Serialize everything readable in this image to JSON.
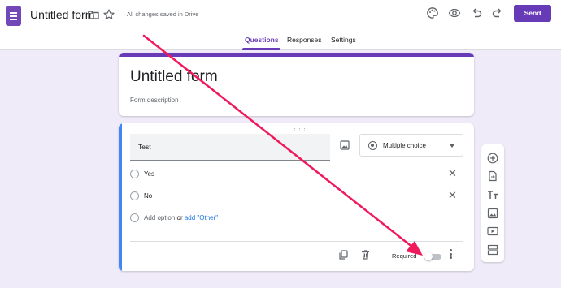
{
  "header": {
    "form_name": "Untitled form",
    "save_status": "All changes saved in Drive",
    "send_label": "Send"
  },
  "tabs": [
    {
      "label": "Questions",
      "active": true
    },
    {
      "label": "Responses",
      "active": false
    },
    {
      "label": "Settings",
      "active": false
    }
  ],
  "form": {
    "title": "Untitled form",
    "description_placeholder": "Form description"
  },
  "question": {
    "text": "Test",
    "type": "Multiple choice",
    "options": [
      {
        "label": "Yes"
      },
      {
        "label": "No"
      }
    ],
    "add_option": "Add option",
    "or": "or",
    "add_other": "add \"Other\"",
    "required_label": "Required",
    "required": false
  },
  "side_toolbar": [
    {
      "icon": "add-question-icon"
    },
    {
      "icon": "import-questions-icon"
    },
    {
      "icon": "add-title-icon"
    },
    {
      "icon": "add-image-icon"
    },
    {
      "icon": "add-video-icon"
    },
    {
      "icon": "add-section-icon"
    }
  ],
  "colors": {
    "accent": "#673ab7",
    "background": "#f0ebf8",
    "focus_bar": "#4285f4",
    "annotation_arrow": "#f0195c"
  }
}
